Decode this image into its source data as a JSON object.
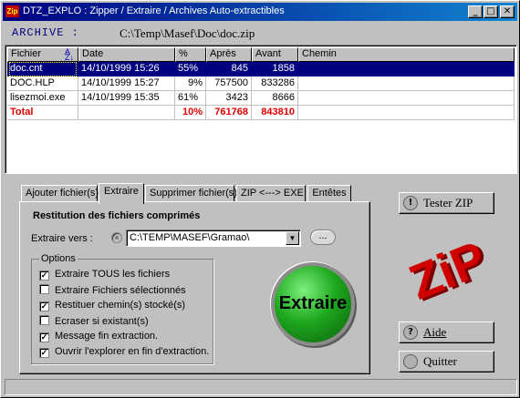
{
  "window": {
    "app_icon": "Zip",
    "title": "DTZ_EXPLO : Zipper / Extraire / Archives Auto-extractibles"
  },
  "archive": {
    "label": "ARCHIVE :",
    "path": "C:\\Temp\\Masef\\Doc\\doc.zip"
  },
  "table": {
    "headers": [
      "Fichier",
      "Date",
      "%",
      "Après",
      "Avant",
      "Chemin"
    ],
    "rows": [
      {
        "name": "doc.cnt",
        "date": "14/10/1999 15:26",
        "pct": "55%",
        "after": "845",
        "before": "1858",
        "path": ""
      },
      {
        "name": "DOC.HLP",
        "date": "14/10/1999 15:27",
        "pct": "9%",
        "after": "757500",
        "before": "833286",
        "path": ""
      },
      {
        "name": "lisezmoi.exe",
        "date": "14/10/1999 15:35",
        "pct": "61%",
        "after": "3423",
        "before": "8666",
        "path": ""
      }
    ],
    "total": {
      "name": "Total",
      "pct": "10%",
      "after": "761768",
      "before": "843810"
    }
  },
  "tabs": [
    "Ajouter fichier(s)",
    "Extraire",
    "Supprimer fichier(s)",
    "ZIP <---> EXE",
    "Entêtes"
  ],
  "extract_panel": {
    "title": "Restitution des fichiers comprimés",
    "dest_label": "Extraire vers :",
    "dest_value": "C:\\TEMP\\MASEF\\Gramao\\",
    "browse_label": "...",
    "options_label": "Options",
    "options": [
      {
        "label": "Extraire TOUS les fichiers",
        "checked": true
      },
      {
        "label": "Extraire Fichiers sélectionnés",
        "checked": false
      },
      {
        "label": "Restituer chemin(s) stocké(s)",
        "checked": true
      },
      {
        "label": "Ecraser si existant(s)",
        "checked": false
      },
      {
        "label": "Message fin extraction.",
        "checked": true
      },
      {
        "label": "Ouvrir l'explorer en fin d'extraction.",
        "checked": true
      }
    ],
    "extract_button": "Extraire"
  },
  "buttons": {
    "test": "Tester ZIP",
    "help": "Aide",
    "quit": "Quitter"
  },
  "logo_text": "ZiP",
  "colors": {
    "title_start": "#000080",
    "title_end": "#1084d0",
    "total": "#e00000",
    "extract_button": "#1ea81e",
    "logo": "#d00000"
  }
}
